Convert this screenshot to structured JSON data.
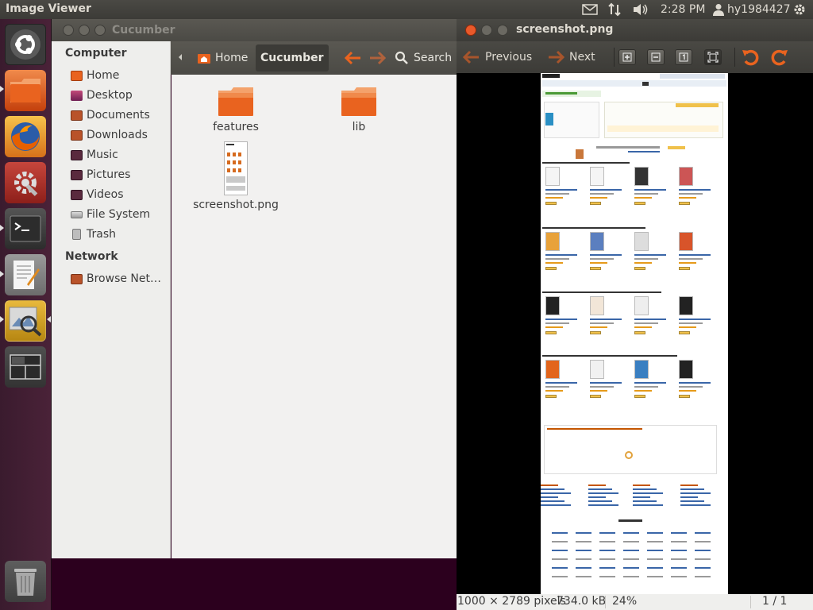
{
  "panel": {
    "app_title": "Image Viewer",
    "time": "2:28 PM",
    "user": "hy1984427",
    "icons": [
      "mail-icon",
      "network-icon",
      "volume-icon",
      "user-icon",
      "settings-gear-icon"
    ]
  },
  "launcher": {
    "items": [
      "dash-home",
      "files",
      "firefox",
      "system-settings",
      "terminal",
      "text-editor",
      "image-viewer",
      "workspace-switcher",
      "trash"
    ]
  },
  "file_manager": {
    "title": "Cucumber",
    "sidebar": {
      "computer_heading": "Computer",
      "computer_items": [
        {
          "label": "Home",
          "icon": "home-folder-icon"
        },
        {
          "label": "Desktop",
          "icon": "desktop-icon"
        },
        {
          "label": "Documents",
          "icon": "documents-folder-icon"
        },
        {
          "label": "Downloads",
          "icon": "downloads-folder-icon"
        },
        {
          "label": "Music",
          "icon": "music-folder-icon"
        },
        {
          "label": "Pictures",
          "icon": "pictures-folder-icon"
        },
        {
          "label": "Videos",
          "icon": "videos-folder-icon"
        },
        {
          "label": "File System",
          "icon": "drive-icon"
        },
        {
          "label": "Trash",
          "icon": "trash-icon"
        }
      ],
      "network_heading": "Network",
      "network_items": [
        {
          "label": "Browse Net…",
          "icon": "network-folder-icon"
        }
      ]
    },
    "breadcrumbs": [
      "Home",
      "Cucumber"
    ],
    "search_label": "Search",
    "files": [
      {
        "name": "features",
        "type": "folder"
      },
      {
        "name": "lib",
        "type": "folder"
      },
      {
        "name": "screenshot.png",
        "type": "image"
      }
    ]
  },
  "image_viewer": {
    "title": "screenshot.png",
    "previous_label": "Previous",
    "next_label": "Next",
    "status": {
      "dimensions": "1000 × 2789 pixels",
      "size": "734.0 kB",
      "zoom": "24%",
      "page": "1 / 1"
    }
  },
  "colors": {
    "accent_orange": "#e95420",
    "panel": "#3c3b37",
    "aubergine": "#2c001e"
  }
}
